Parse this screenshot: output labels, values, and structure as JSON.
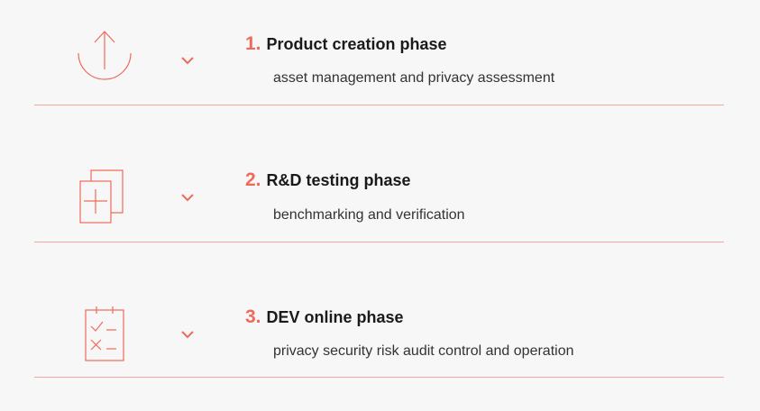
{
  "colors": {
    "accent": "#ee6b5a",
    "divider": "#f0a89e",
    "background": "#f7f7f7",
    "title": "#1a1a1a",
    "description": "#333333"
  },
  "phases": [
    {
      "number": "1.",
      "title": "Product creation phase",
      "description": "asset management and privacy assessment",
      "icon": "upload-arrow-icon"
    },
    {
      "number": "2.",
      "title": "R&D testing phase",
      "description": "benchmarking and verification",
      "icon": "add-document-icon"
    },
    {
      "number": "3.",
      "title": "DEV online phase",
      "description": "privacy security risk audit control and operation",
      "icon": "checklist-icon"
    }
  ]
}
